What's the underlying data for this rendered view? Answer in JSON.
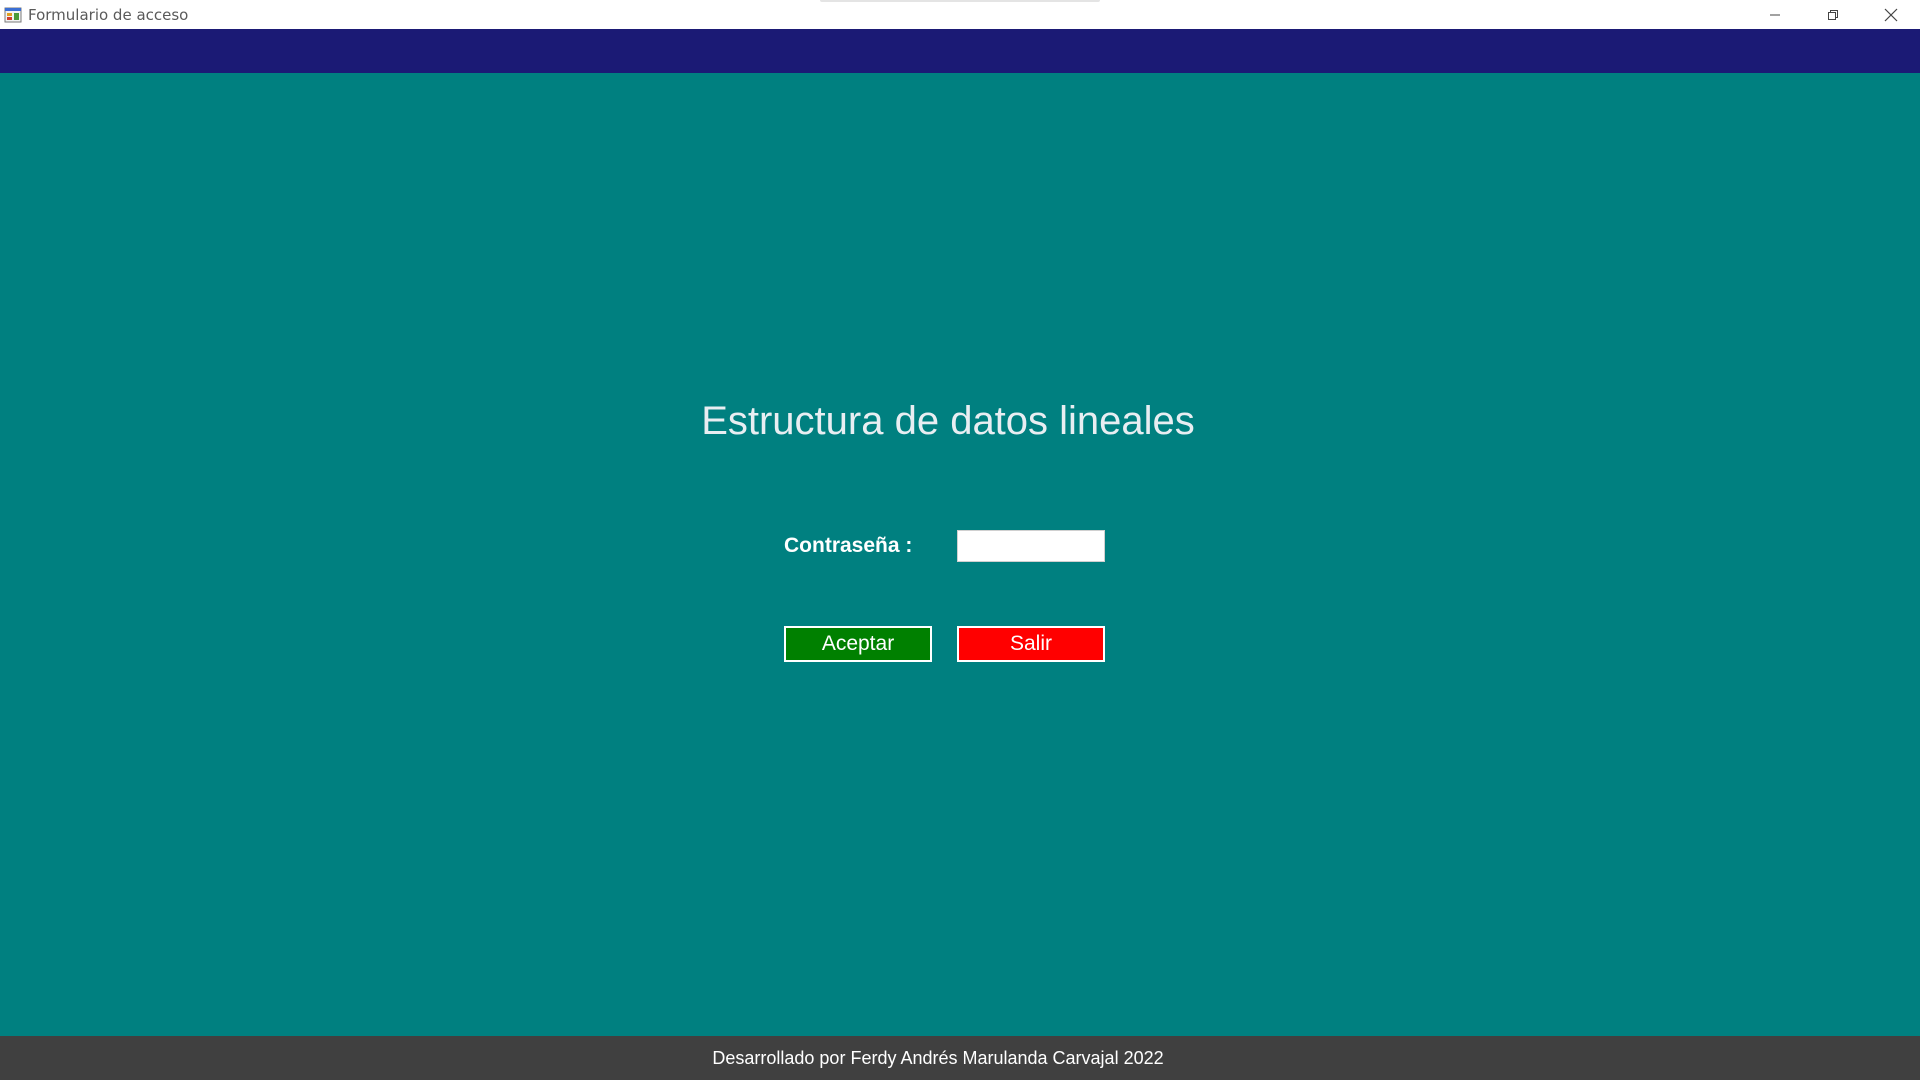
{
  "window": {
    "title": "Formulario de acceso",
    "controls": [
      "minimize",
      "restore",
      "close"
    ]
  },
  "colors": {
    "background": "#008080",
    "top_band": "#1b1a75",
    "footer": "#404040",
    "accept_button": "#008000",
    "exit_button": "#ff0000"
  },
  "main": {
    "heading": "Estructura de datos lineales",
    "password_label": "Contraseña :",
    "password_value": "",
    "accept_label": "Aceptar",
    "exit_label": "Salir"
  },
  "footer": {
    "text": "Desarrollado por Ferdy Andrés Marulanda Carvajal 2022"
  },
  "icons": {
    "app": "form-app-icon",
    "minimize": "minimize-icon",
    "restore": "restore-icon",
    "close": "close-icon"
  }
}
